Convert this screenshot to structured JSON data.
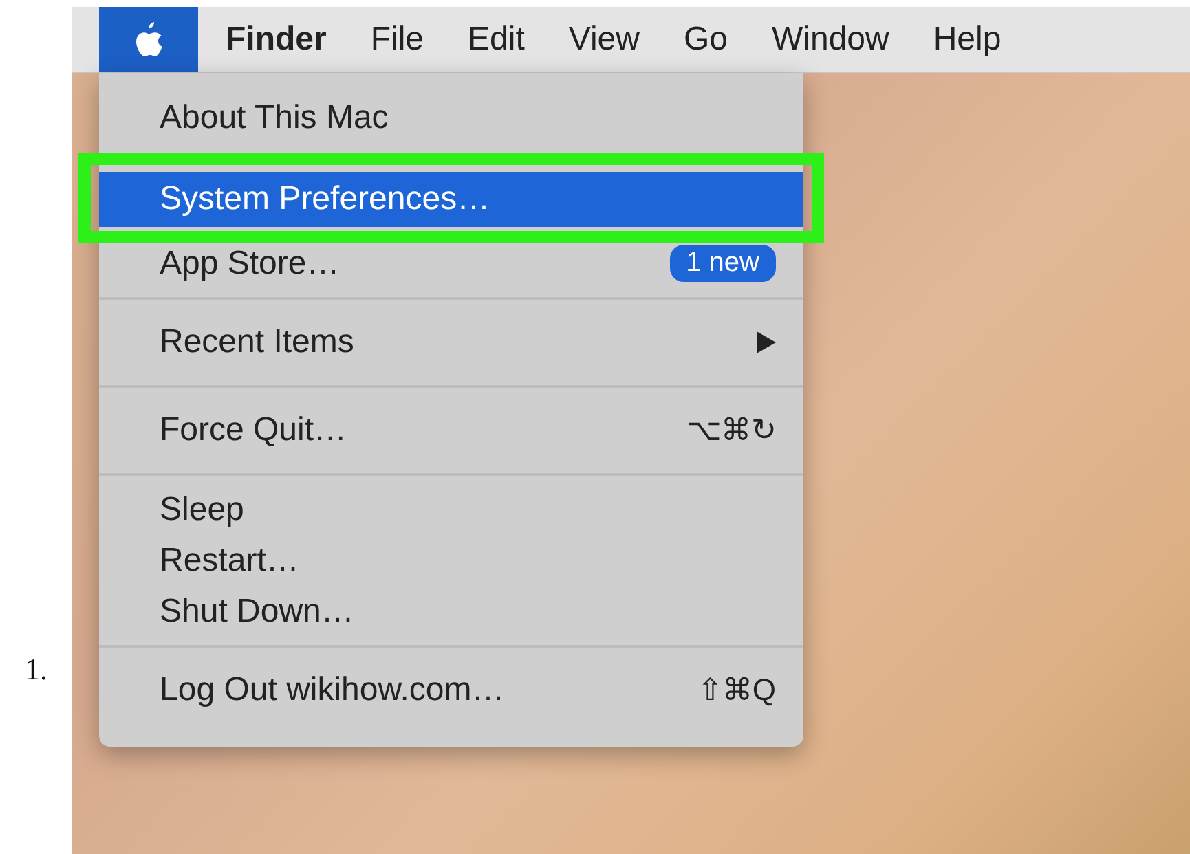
{
  "step_number": "1.",
  "menu_bar": {
    "apple_selected": true,
    "items": [
      {
        "label": "Finder",
        "kind": "app"
      },
      {
        "label": "File",
        "kind": "menu"
      },
      {
        "label": "Edit",
        "kind": "menu"
      },
      {
        "label": "View",
        "kind": "menu"
      },
      {
        "label": "Go",
        "kind": "menu"
      },
      {
        "label": "Window",
        "kind": "menu"
      },
      {
        "label": "Help",
        "kind": "menu"
      }
    ]
  },
  "menu": {
    "groups": [
      {
        "items": [
          {
            "label": "About This Mac",
            "selected": false
          }
        ]
      },
      {
        "items": [
          {
            "label": "System Preferences…",
            "selected": true,
            "annotated": true
          },
          {
            "label": "App Store…",
            "selected": false,
            "badge": "1 new"
          }
        ]
      },
      {
        "items": [
          {
            "label": "Recent Items",
            "selected": false,
            "submenu": true
          }
        ]
      },
      {
        "items": [
          {
            "label": "Force Quit…",
            "selected": false,
            "shortcut": "⌥⌘↻"
          }
        ]
      },
      {
        "items": [
          {
            "label": "Sleep",
            "selected": false
          },
          {
            "label": "Restart…",
            "selected": false
          },
          {
            "label": "Shut Down…",
            "selected": false
          }
        ]
      },
      {
        "items": [
          {
            "label": "Log Out wikihow.com…",
            "selected": false,
            "shortcut": "⇧⌘Q"
          }
        ]
      }
    ]
  }
}
